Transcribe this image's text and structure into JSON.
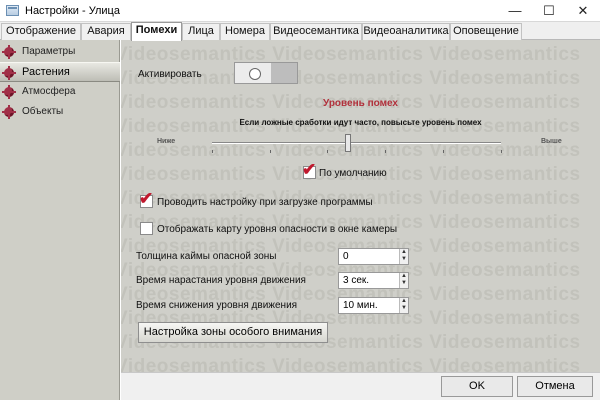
{
  "window": {
    "title": "Настройки - Улица",
    "minimize_glyph": "—",
    "maximize_glyph": "☐",
    "close_glyph": "✕"
  },
  "tabs": [
    {
      "label": "Отображение"
    },
    {
      "label": "Авария"
    },
    {
      "label": "Помехи",
      "active": true
    },
    {
      "label": "Лица"
    },
    {
      "label": "Номера"
    },
    {
      "label": "Видеосемантика"
    },
    {
      "label": "Видеоаналитика"
    },
    {
      "label": "Оповещение"
    }
  ],
  "sidebar": {
    "items": [
      {
        "label": "Параметры",
        "icon": "cross-bullet-icon"
      },
      {
        "label": "Растения",
        "icon": "cross-bullet-icon",
        "selected": true
      },
      {
        "label": "Атмосфера",
        "icon": "cross-bullet-icon"
      },
      {
        "label": "Объекты",
        "icon": "cross-bullet-icon"
      }
    ]
  },
  "main": {
    "watermark_text": "Videosemantics Videosemantics Videosemantics",
    "activate_label": "Активировать",
    "activate_state": "off",
    "level": {
      "title": "Уровень помех",
      "hint": "Если ложные сработки идут часто, повысьте уровень помех",
      "low_label": "Ниже",
      "high_label": "Выше",
      "value_fraction": 0.47
    },
    "default_checkbox": {
      "label": "По умолчанию",
      "checked": true
    },
    "on_startup_checkbox": {
      "label": "Проводить настройку при загрузке программы",
      "checked": true
    },
    "danger_map_checkbox": {
      "label": "Отображать карту уровня опасности в окне камеры",
      "checked": false
    },
    "fields": [
      {
        "label": "Толщина каймы опасной зоны",
        "value": "0"
      },
      {
        "label": "Время нарастания уровня движения",
        "value": "3 сек."
      },
      {
        "label": "Время снижения уровня движения",
        "value": "10 мин."
      }
    ],
    "zone_button": "Настройка зоны особого внимания"
  },
  "dialog": {
    "ok": "OK",
    "cancel": "Отмена"
  },
  "colors": {
    "accent_red": "#b1303b",
    "check_red": "#c0192e",
    "panel_bg": "#cfcfc9"
  }
}
